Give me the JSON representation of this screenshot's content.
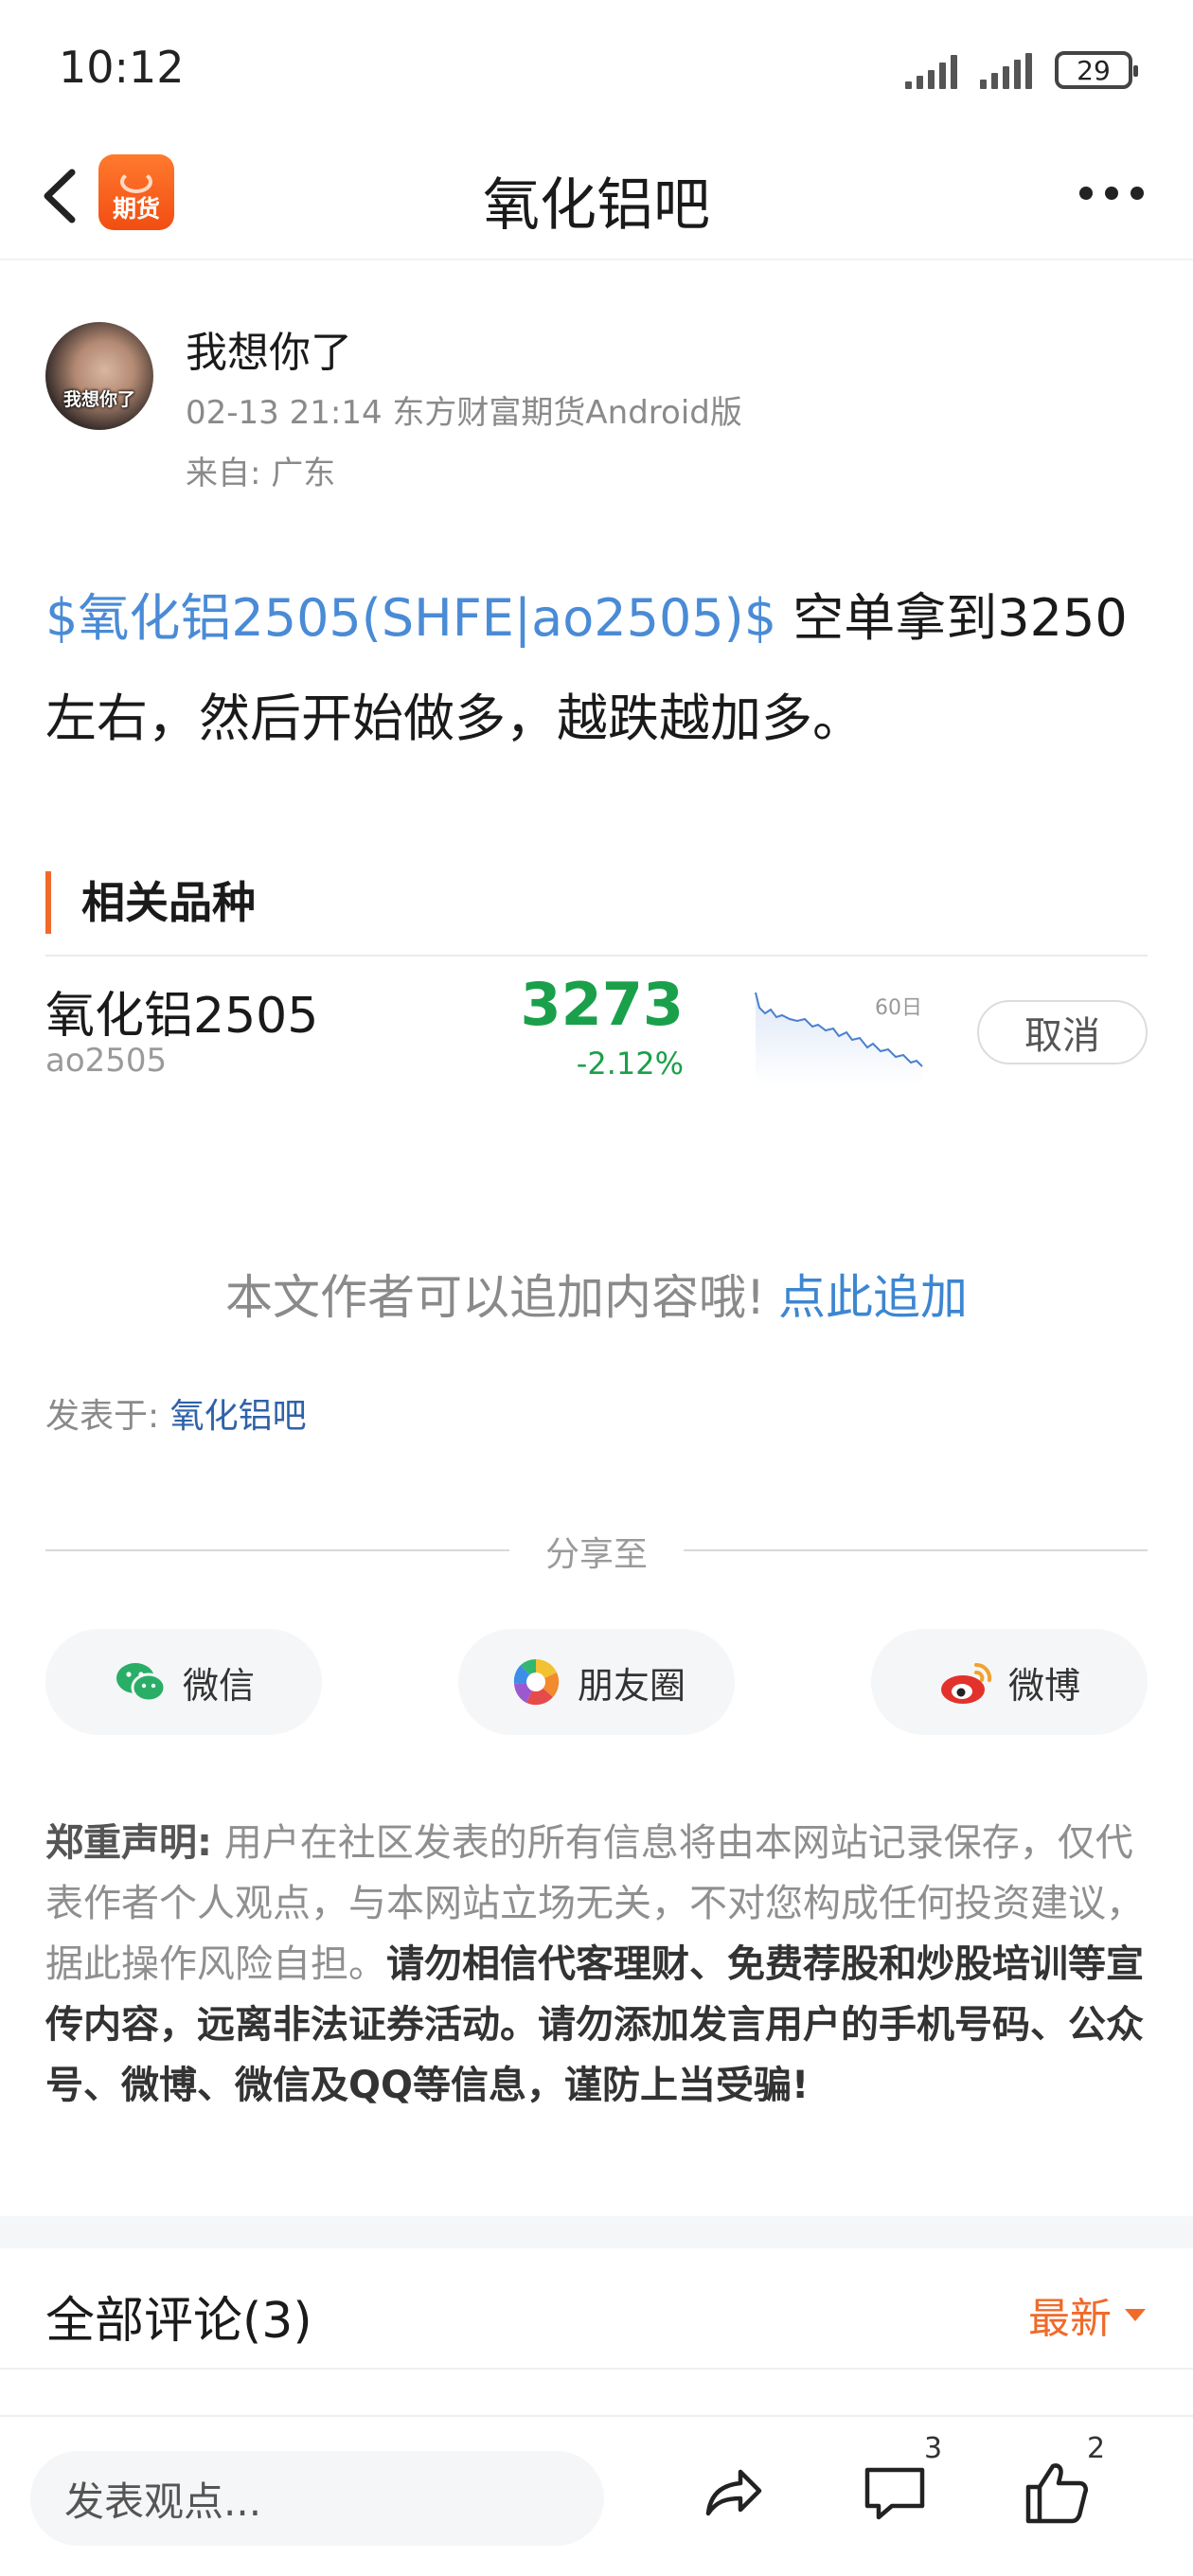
{
  "status_bar": {
    "time": "10:12",
    "battery": "29"
  },
  "header": {
    "title": "氧化铝吧",
    "logo_text": "期货"
  },
  "author": {
    "name": "我想你了",
    "avatar_caption": "我想你了",
    "meta": "02-13 21:14 东方财富期货Android版",
    "location": "来自: 广东"
  },
  "post": {
    "stock_link": "$氧化铝2505(SHFE|ao2505)$",
    "text": " 空单拿到3250左右，然后开始做多，越跌越加多。"
  },
  "related": {
    "heading": "相关品种",
    "item": {
      "name": "氧化铝2505",
      "code": "ao2505",
      "price": "3273",
      "change": "-2.12%",
      "sparkline_period": "60日",
      "sparkline_trend": "down",
      "cancel_label": "取消",
      "color": "#1aa04a"
    }
  },
  "append": {
    "prompt": "本文作者可以追加内容哦!",
    "link": "点此追加"
  },
  "posted_in": {
    "label": "发表于: ",
    "forum": "氧化铝吧"
  },
  "share": {
    "title": "分享至",
    "buttons": [
      {
        "label": "微信",
        "icon": "wechat-icon"
      },
      {
        "label": "朋友圈",
        "icon": "moments-icon"
      },
      {
        "label": "微博",
        "icon": "weibo-icon"
      }
    ]
  },
  "disclaimer": {
    "label": "郑重声明:",
    "text": " 用户在社区发表的所有信息将由本网站记录保存，仅代表作者个人观点，与本网站立场无关，不对您构成任何投资建议，据此操作风险自担。",
    "strong": "请勿相信代客理财、免费荐股和炒股培训等宣传内容，远离非法证券活动。请勿添加发言用户的手机号码、公众号、微博、微信及QQ等信息，谨防上当受骗!"
  },
  "comments": {
    "title": "全部评论(3)",
    "sort_label": "最新"
  },
  "bottom_bar": {
    "input_placeholder": "发表观点...",
    "comment_count": "3",
    "like_count": "2"
  },
  "colors": {
    "accent": "#f06a2a",
    "link": "#4a8bd6",
    "up_down_green": "#1aa04a"
  }
}
